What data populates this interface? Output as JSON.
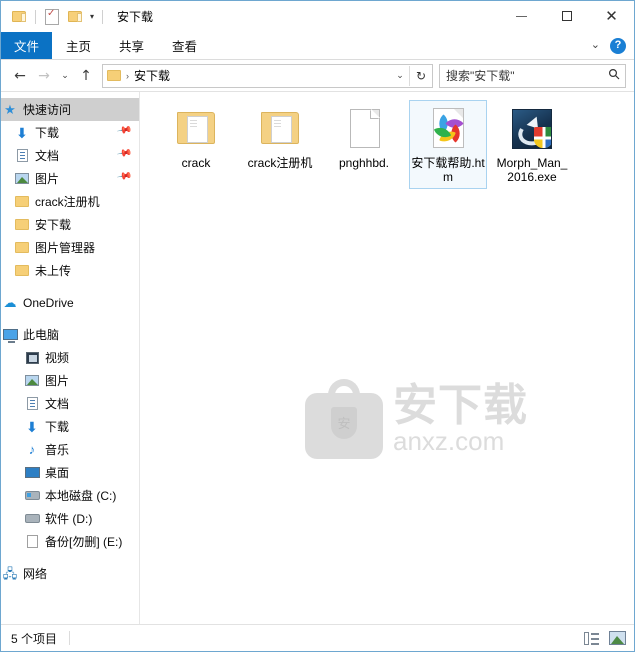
{
  "window": {
    "title": "安下载",
    "quick_access": [
      {
        "name": "save-folder-icon",
        "label": "保存"
      },
      {
        "name": "properties-icon",
        "label": "属性"
      },
      {
        "name": "new-folder-icon",
        "label": "新建文件夹"
      },
      {
        "name": "customize-chevron-icon",
        "label": "▾"
      }
    ],
    "controls": {
      "minimize": "—",
      "maximize": "□",
      "close": "✕"
    }
  },
  "ribbon": {
    "tabs": [
      {
        "label": "文件",
        "active": true
      },
      {
        "label": "主页",
        "active": false
      },
      {
        "label": "共享",
        "active": false
      },
      {
        "label": "查看",
        "active": false
      }
    ],
    "expand_chevron": "⌄",
    "help_label": "?"
  },
  "addressbar": {
    "back": "←",
    "forward": "→",
    "history": "⌄",
    "up": "↑",
    "crumb_icon": "folder-icon",
    "crumb_sep": "›",
    "crumb": "安下载",
    "dropdown": "⌄",
    "refresh": "↻",
    "search_placeholder": "搜索\"安下载\"",
    "search_value": "",
    "search_icon": "🔍"
  },
  "sidebar": {
    "items": [
      {
        "label": "快速访问",
        "icon": "star-pin-icon",
        "indent": 0,
        "selected": true,
        "pinned": false
      },
      {
        "label": "下载",
        "icon": "download-icon",
        "indent": 1,
        "selected": false,
        "pinned": true
      },
      {
        "label": "文档",
        "icon": "documents-icon",
        "indent": 1,
        "selected": false,
        "pinned": true
      },
      {
        "label": "图片",
        "icon": "pictures-icon",
        "indent": 1,
        "selected": false,
        "pinned": true
      },
      {
        "label": "crack注册机",
        "icon": "folder-icon",
        "indent": 1,
        "selected": false,
        "pinned": false
      },
      {
        "label": "安下载",
        "icon": "folder-icon",
        "indent": 1,
        "selected": false,
        "pinned": false
      },
      {
        "label": "图片管理器",
        "icon": "folder-icon",
        "indent": 1,
        "selected": false,
        "pinned": false
      },
      {
        "label": "未上传",
        "icon": "folder-icon",
        "indent": 1,
        "selected": false,
        "pinned": false
      },
      {
        "label": "OneDrive",
        "icon": "cloud-icon",
        "indent": 0,
        "selected": false,
        "pinned": false,
        "gap_before": true
      },
      {
        "label": "此电脑",
        "icon": "computer-icon",
        "indent": 0,
        "selected": false,
        "pinned": false,
        "gap_before": true
      },
      {
        "label": "视频",
        "icon": "videos-icon",
        "indent": 1,
        "selected": false,
        "pinned": false
      },
      {
        "label": "图片",
        "icon": "pictures-icon",
        "indent": 1,
        "selected": false,
        "pinned": false
      },
      {
        "label": "文档",
        "icon": "documents-icon",
        "indent": 1,
        "selected": false,
        "pinned": false
      },
      {
        "label": "下载",
        "icon": "download-icon",
        "indent": 1,
        "selected": false,
        "pinned": false
      },
      {
        "label": "音乐",
        "icon": "music-icon",
        "indent": 1,
        "selected": false,
        "pinned": false
      },
      {
        "label": "桌面",
        "icon": "desktop-icon",
        "indent": 1,
        "selected": false,
        "pinned": false
      },
      {
        "label": "本地磁盘 (C:)",
        "icon": "system-drive-icon",
        "indent": 1,
        "selected": false,
        "pinned": false
      },
      {
        "label": "软件 (D:)",
        "icon": "drive-icon",
        "indent": 1,
        "selected": false,
        "pinned": false
      },
      {
        "label": "备份[勿删] (E:)",
        "icon": "drive-blank-icon",
        "indent": 1,
        "selected": false,
        "pinned": false
      },
      {
        "label": "网络",
        "icon": "network-icon",
        "indent": 0,
        "selected": false,
        "pinned": false,
        "gap_before": true
      }
    ]
  },
  "content": {
    "items": [
      {
        "label": "crack",
        "icon": "folder-icon",
        "selected": false
      },
      {
        "label": "crack注册机",
        "icon": "folder-icon",
        "selected": false
      },
      {
        "label": "pnghhbd.",
        "icon": "blank-document-icon",
        "selected": false
      },
      {
        "label": "安下载帮助.htm",
        "icon": "html-file-icon",
        "selected": true
      },
      {
        "label": "Morph_Man_2016.exe",
        "icon": "executable-icon",
        "selected": false
      }
    ],
    "watermark": {
      "logo_char": "安",
      "chinese": "安下载",
      "domain": "anxz.com"
    }
  },
  "statusbar": {
    "item_count": "5 个项目",
    "views": [
      {
        "name": "details-view-button",
        "label": "详细信息",
        "active": false
      },
      {
        "name": "large-icons-view-button",
        "label": "大图标",
        "active": true
      }
    ]
  },
  "colors": {
    "accent_blue": "#0b72c4",
    "window_border": "#6ea7d0",
    "selection_fill": "#f3f9fd",
    "selection_border": "#a9d3f0",
    "sidebar_selected": "#cfcfcf",
    "folder_yellow": "#f4d184",
    "watermark_gray": "#dcdcdc"
  }
}
